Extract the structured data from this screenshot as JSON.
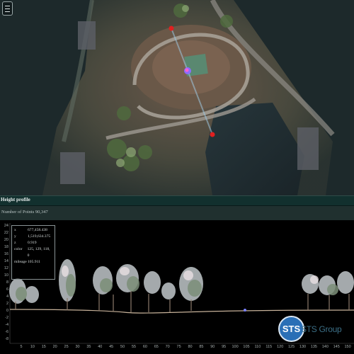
{
  "menu": {
    "icon": "hamburger-icon"
  },
  "profile_panel": {
    "title": "Height profile",
    "points_label": "Number of Points 90,347"
  },
  "tooltip": {
    "rows": [
      {
        "key": "x",
        "value": "677,458.438"
      },
      {
        "key": "y",
        "value": "1,519,634.375"
      },
      {
        "key": "z",
        "value": "0.919"
      },
      {
        "key": "color",
        "value": "125, 129, 118, 0"
      },
      {
        "key": "mileage",
        "value": "105.911"
      }
    ]
  },
  "axes": {
    "y_ticks": [
      "24",
      "22",
      "20",
      "18",
      "16",
      "14",
      "12",
      "10",
      "8",
      "6",
      "4",
      "2",
      "0",
      "-2",
      "-4",
      "-6",
      "-8"
    ],
    "x_ticks": [
      "5",
      "10",
      "15",
      "20",
      "25",
      "30",
      "35",
      "40",
      "45",
      "50",
      "55",
      "60",
      "65",
      "70",
      "75",
      "80",
      "85",
      "90",
      "95",
      "100",
      "105",
      "110",
      "115",
      "120",
      "125",
      "130",
      "135",
      "140",
      "145",
      "150"
    ]
  },
  "logo": {
    "mark": "STS",
    "text": "STS Group"
  },
  "colors": {
    "panel_header": "#12302e",
    "plot_bg": "#000000",
    "logo_blue": "#2a6fb6",
    "marker": "#e02020"
  }
}
